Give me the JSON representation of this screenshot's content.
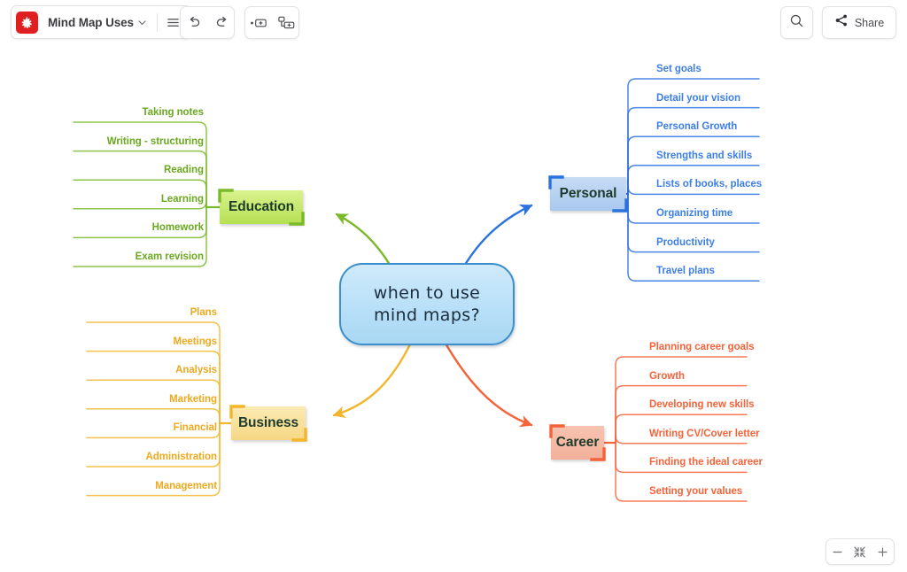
{
  "toolbar": {
    "logo_icon": "mindmeister-logo-icon",
    "document_title": "Mind Map Uses",
    "title_caret_icon": "chevron-down-icon",
    "menu_icon": "hamburger-menu-icon",
    "undo_icon": "undo-arrow-icon",
    "redo_icon": "redo-arrow-icon",
    "add_sibling_icon": "add-sibling-node-icon",
    "add_child_icon": "add-child-node-icon",
    "search_icon": "search-icon",
    "share_icon": "share-icon",
    "share_label": "Share"
  },
  "zoom_controls": {
    "zoom_out_label": "−",
    "fit_icon": "fit-to-screen-icon",
    "zoom_in_label": "+"
  },
  "mindmap": {
    "root": {
      "line1": "when to use",
      "line2": "mind maps?",
      "fill": "#bce2f8",
      "stroke": "#3d8fcb"
    },
    "branches": [
      {
        "id": "education",
        "label": "Education",
        "color": "#7ab929",
        "text_color": "#6aa81f",
        "fill_from": "#d9f28e",
        "fill_to": "#b5e053",
        "side": "left",
        "leaves": [
          "Taking notes",
          "Writing - structuring",
          "Reading",
          "Learning",
          "Homework",
          "Exam revision"
        ]
      },
      {
        "id": "personal",
        "label": "Personal",
        "color": "#2a72e0",
        "text_color": "#3d7fe6",
        "fill_from": "#c6dcf5",
        "fill_to": "#a9c8ee",
        "side": "right",
        "leaves": [
          "Set goals",
          "Detail your vision",
          "Personal Growth",
          "Strengths and skills",
          "Lists of books, places",
          "Organizing time",
          "Productivity",
          "Travel plans"
        ]
      },
      {
        "id": "business",
        "label": "Business",
        "color": "#f3b52c",
        "text_color": "#efa91f",
        "fill_from": "#fbeab4",
        "fill_to": "#f6d884",
        "side": "left",
        "leaves": [
          "Plans",
          "Meetings",
          "Analysis",
          "Marketing",
          "Financial",
          "Administration",
          "Management"
        ]
      },
      {
        "id": "career",
        "label": "Career",
        "color": "#f4633a",
        "text_color": "#f4633a",
        "fill_from": "#f7c3b1",
        "fill_to": "#f2b09a",
        "side": "right",
        "leaves": [
          "Planning career goals",
          "Growth",
          "Developing new skills",
          "Writing CV/Cover letter",
          "Finding the ideal career",
          "Setting  your values"
        ]
      }
    ]
  }
}
